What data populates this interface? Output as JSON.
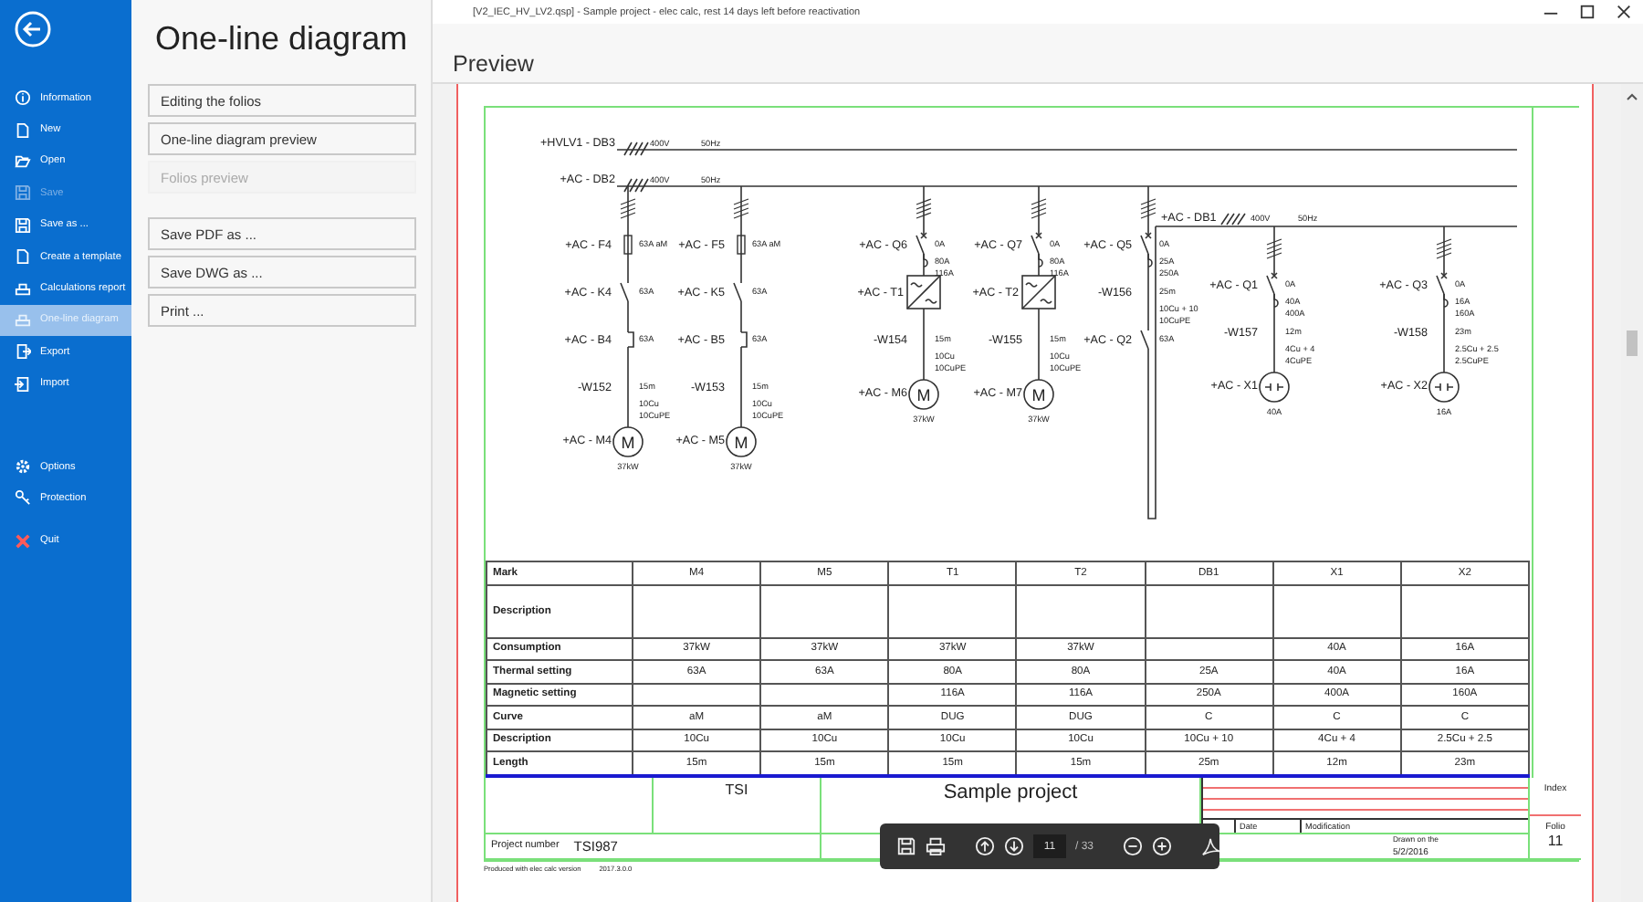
{
  "window": {
    "title": "[V2_IEC_HV_LV2.qsp] - Sample project - elec calc, rest 14 days left before reactivation"
  },
  "sidebar": {
    "items": [
      {
        "label": "Information",
        "selected": false,
        "disabled": false
      },
      {
        "label": "New",
        "selected": false,
        "disabled": false
      },
      {
        "label": "Open",
        "selected": false,
        "disabled": false
      },
      {
        "label": "Save",
        "selected": false,
        "disabled": true
      },
      {
        "label": "Save as ...",
        "selected": false,
        "disabled": false
      },
      {
        "label": "Create a template",
        "selected": false,
        "disabled": false
      },
      {
        "label": "Calculations report",
        "selected": false,
        "disabled": false
      },
      {
        "label": "One-line diagram",
        "selected": true,
        "disabled": false
      },
      {
        "label": "Export",
        "selected": false,
        "disabled": false
      },
      {
        "label": "Import",
        "selected": false,
        "disabled": false
      }
    ],
    "bottom_items": [
      {
        "label": "Options",
        "selected": false,
        "disabled": false
      },
      {
        "label": "Protection",
        "selected": false,
        "disabled": false
      },
      {
        "label": "Quit",
        "selected": false,
        "disabled": false
      }
    ]
  },
  "panel": {
    "title": "One-line diagram",
    "actions": [
      {
        "label": "Editing the folios",
        "disabled": false
      },
      {
        "label": "One-line diagram preview",
        "disabled": false
      },
      {
        "label": "Folios preview",
        "disabled": true
      }
    ],
    "export_actions": [
      {
        "label": "Save PDF as ...",
        "disabled": false
      },
      {
        "label": "Save DWG as ...",
        "disabled": false
      },
      {
        "label": "Print ...",
        "disabled": false
      }
    ]
  },
  "preview": {
    "title": "Preview",
    "diagram": {
      "buses": [
        {
          "label": "+HVLV1 - DB3",
          "voltage": "400V",
          "frequency": "50Hz"
        },
        {
          "label": "+AC - DB2",
          "voltage": "400V",
          "frequency": "50Hz",
          "feeders": [
            {
              "elements": [
                {
                  "kind": "fuse",
                  "label": "+AC - F4",
                  "notes": [
                    "63A aM"
                  ]
                },
                {
                  "kind": "contactor",
                  "label": "+AC - K4",
                  "notes": [
                    "63A"
                  ]
                },
                {
                  "kind": "relay",
                  "label": "+AC - B4",
                  "notes": [
                    "63A"
                  ]
                },
                {
                  "kind": "cable",
                  "label": "-W152",
                  "notes": [
                    "15m",
                    "10Cu",
                    "10CuPE"
                  ]
                },
                {
                  "kind": "motor",
                  "label": "+AC - M4",
                  "symbol": "M",
                  "notes": [
                    "37kW"
                  ]
                }
              ]
            },
            {
              "elements": [
                {
                  "kind": "fuse",
                  "label": "+AC - F5",
                  "notes": [
                    "63A aM"
                  ]
                },
                {
                  "kind": "contactor",
                  "label": "+AC - K5",
                  "notes": [
                    "63A"
                  ]
                },
                {
                  "kind": "relay",
                  "label": "+AC - B5",
                  "notes": [
                    "63A"
                  ]
                },
                {
                  "kind": "cable",
                  "label": "-W153",
                  "notes": [
                    "15m",
                    "10Cu",
                    "10CuPE"
                  ]
                },
                {
                  "kind": "motor",
                  "label": "+AC - M5",
                  "symbol": "M",
                  "notes": [
                    "37kW"
                  ]
                }
              ]
            },
            {
              "elements": [
                {
                  "kind": "breaker",
                  "label": "+AC - Q6",
                  "notes": [
                    "0A",
                    "80A",
                    "116A"
                  ]
                },
                {
                  "kind": "transformer",
                  "label": "+AC - T1"
                },
                {
                  "kind": "cable",
                  "label": "-W154",
                  "notes": [
                    "15m",
                    "10Cu",
                    "10CuPE"
                  ]
                },
                {
                  "kind": "motor",
                  "label": "+AC - M6",
                  "symbol": "M",
                  "notes": [
                    "37kW"
                  ]
                }
              ]
            },
            {
              "elements": [
                {
                  "kind": "breaker",
                  "label": "+AC - Q7",
                  "notes": [
                    "0A",
                    "80A",
                    "116A"
                  ]
                },
                {
                  "kind": "transformer",
                  "label": "+AC - T2"
                },
                {
                  "kind": "cable",
                  "label": "-W155",
                  "notes": [
                    "15m",
                    "10Cu",
                    "10CuPE"
                  ]
                },
                {
                  "kind": "motor",
                  "label": "+AC - M7",
                  "symbol": "M",
                  "notes": [
                    "37kW"
                  ]
                }
              ]
            },
            {
              "elements": [
                {
                  "kind": "breaker",
                  "label": "+AC - Q5",
                  "notes": [
                    "0A",
                    "25A",
                    "250A"
                  ]
                },
                {
                  "kind": "cable",
                  "label": "-W156",
                  "notes": [
                    "25m",
                    "10Cu + 10",
                    "10CuPE"
                  ]
                },
                {
                  "kind": "contactor",
                  "label": "+AC - Q2",
                  "notes": [
                    "63A"
                  ]
                }
              ],
              "sub_bus": {
                "label": "+AC - DB1",
                "voltage": "400V",
                "frequency": "50Hz",
                "feeders": [
                  {
                    "elements": [
                      {
                        "kind": "breaker",
                        "label": "+AC - Q1",
                        "notes": [
                          "0A",
                          "40A",
                          "400A"
                        ]
                      },
                      {
                        "kind": "cable",
                        "label": "-W157",
                        "notes": [
                          "12m",
                          "4Cu + 4",
                          "4CuPE"
                        ]
                      },
                      {
                        "kind": "socket",
                        "label": "+AC - X1",
                        "notes": [
                          "40A"
                        ]
                      }
                    ]
                  },
                  {
                    "elements": [
                      {
                        "kind": "breaker",
                        "label": "+AC - Q3",
                        "notes": [
                          "0A",
                          "16A",
                          "160A"
                        ]
                      },
                      {
                        "kind": "cable",
                        "label": "-W158",
                        "notes": [
                          "23m",
                          "2.5Cu + 2.5",
                          "2.5CuPE"
                        ]
                      },
                      {
                        "kind": "socket",
                        "label": "+AC - X2",
                        "notes": [
                          "16A"
                        ]
                      }
                    ]
                  }
                ]
              }
            }
          ]
        }
      ]
    },
    "table": {
      "rows": [
        {
          "kind": "header",
          "label": "Mark",
          "cells": [
            "M4",
            "M5",
            "T1",
            "T2",
            "DB1",
            "X1",
            "X2"
          ]
        },
        {
          "kind": "tall",
          "label": "Description",
          "cells": [
            null,
            null,
            null,
            null,
            null,
            null,
            null
          ]
        },
        {
          "kind": "normal",
          "label": "Consumption",
          "cells": [
            "37kW",
            "37kW",
            "37kW",
            "37kW",
            null,
            "40A",
            "16A"
          ]
        },
        {
          "kind": "normal",
          "label": "Thermal setting",
          "cells": [
            "63A",
            "63A",
            "80A",
            "80A",
            "25A",
            "40A",
            "16A"
          ]
        },
        {
          "kind": "normal",
          "label": "Magnetic setting",
          "cells": [
            null,
            null,
            "116A",
            "116A",
            "250A",
            "400A",
            "160A"
          ]
        },
        {
          "kind": "normal",
          "label": "Curve",
          "cells": [
            "aM",
            "aM",
            "DUG",
            "DUG",
            "C",
            "C",
            "C"
          ]
        },
        {
          "kind": "normal",
          "label": "Description",
          "cells": [
            "10Cu",
            "10Cu",
            "10Cu",
            "10Cu",
            "10Cu + 10",
            "4Cu + 4",
            "2.5Cu + 2.5"
          ]
        },
        {
          "kind": "normal",
          "label": "Length",
          "cells": [
            "15m",
            "15m",
            "15m",
            "15m",
            "25m",
            "12m",
            "23m"
          ]
        }
      ]
    },
    "title_block": {
      "company": "TSI",
      "project": "Sample project",
      "date_label": "Date",
      "modification_label": "Modification",
      "index_label": "Index",
      "folio_label": "Folio",
      "folio": "11",
      "project_number_label": "Project number",
      "project_number": "TSI987",
      "drawn_label": "Drawn on the",
      "drawn_date": "5/2/2016"
    },
    "footer": {
      "text": "Produced with elec calc version",
      "version": "2017.3.0.0"
    }
  },
  "viewer_toolbar": {
    "page": "11",
    "page_count": "/ 33"
  }
}
